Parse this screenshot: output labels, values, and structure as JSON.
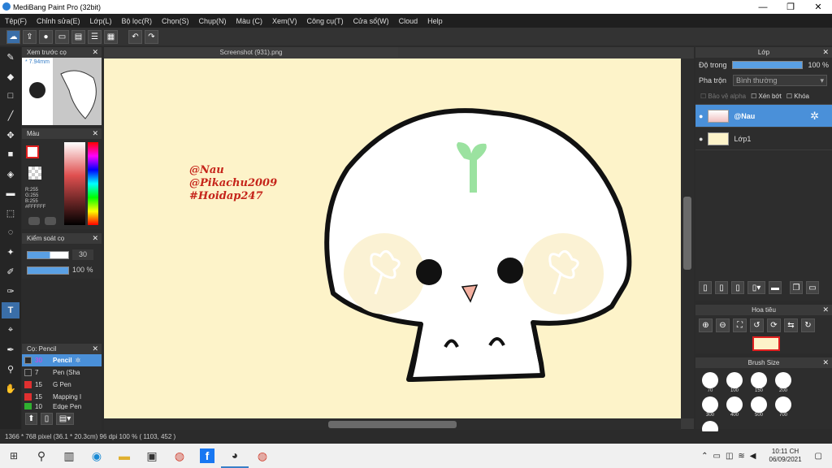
{
  "window": {
    "title": "MediBang Paint Pro (32bit)",
    "min": "—",
    "max": "❐",
    "close": "✕"
  },
  "menu": [
    "Tệp(F)",
    "Chỉnh sửa(E)",
    "Lớp(L)",
    "Bộ lọc(R)",
    "Chọn(S)",
    "Chụp(N)",
    "Màu (C)",
    "Xem(V)",
    "Công cụ(T)",
    "Cửa sổ(W)",
    "Cloud",
    "Help"
  ],
  "brush_preview": {
    "title": "Xem trước cọ",
    "size": "7.94mm"
  },
  "color_panel": {
    "title": "Màu",
    "r": "R:255",
    "g": "G:255",
    "b": "B:255",
    "hex": "#FFFFFF"
  },
  "brush_control": {
    "title": "Kiểm soát cọ",
    "size_value": "30",
    "opacity_value": "100 %"
  },
  "brush_list": {
    "title": "Cọ: Pencil",
    "items": [
      {
        "size": "30",
        "name": "Pencil",
        "color": "#2b2b2b"
      },
      {
        "size": "7",
        "name": "Pen (Sha",
        "color": "#2b2b2b"
      },
      {
        "size": "15",
        "name": "G Pen",
        "color": "#e03030"
      },
      {
        "size": "15",
        "name": "Mapping I",
        "color": "#e03030"
      },
      {
        "size": "10",
        "name": "Edge Pen",
        "color": "#30b030"
      }
    ]
  },
  "document": {
    "tab": "Screenshot (931).png"
  },
  "watermark": [
    "@Nau",
    "@Pikachu2009",
    "#Hoidap247"
  ],
  "layer_panel": {
    "title": "Lớp",
    "opacity_label": "Độ trong",
    "opacity_value": "100 %",
    "blend_label": "Pha trộn",
    "blend_value": "Bình thường",
    "protect_alpha": "Bảo vệ alpha",
    "clip": "Xén bớt",
    "lock": "Khóa",
    "layers": [
      {
        "name": "@Nau"
      },
      {
        "name": "Lớp1"
      }
    ]
  },
  "navigator": {
    "title": "Hoa tiêu"
  },
  "brush_size": {
    "title": "Brush Size",
    "sizes": [
      "70",
      "100",
      "150",
      "200",
      "300",
      "400",
      "500",
      "700",
      "1000"
    ]
  },
  "status": {
    "text": "1366 * 768 pixel   (36.1 * 20.3cm)   96 dpi   100 %   ( 1103, 452 )"
  },
  "taskbar": {
    "time": "10:11 CH",
    "date": "06/09/2021"
  }
}
